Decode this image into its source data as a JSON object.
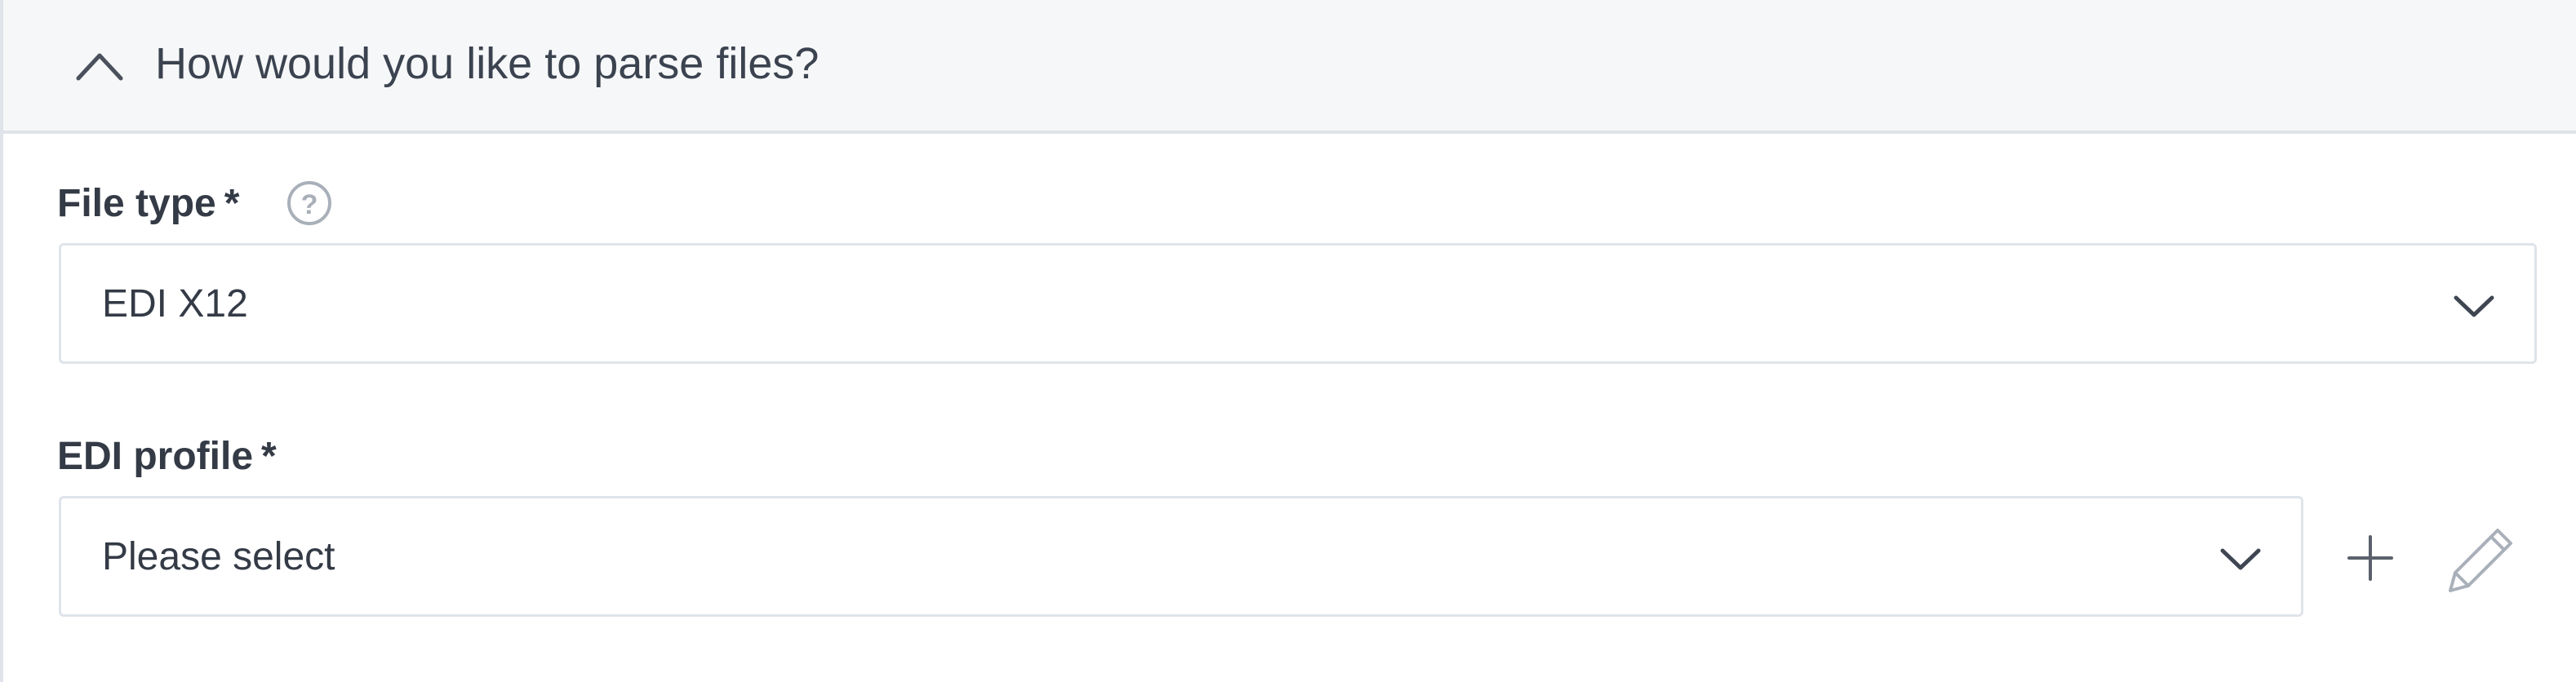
{
  "section": {
    "title": "How would you like to parse files?",
    "toggle_icon": "chevron-up-icon"
  },
  "file_type": {
    "label": "File type",
    "required_marker": "*",
    "help_icon": "help-circle-icon",
    "selected_value": "EDI X12",
    "dropdown_icon": "chevron-down-icon"
  },
  "edi_profile": {
    "label": "EDI profile",
    "required_marker": "*",
    "selected_value": "Please select",
    "dropdown_icon": "chevron-down-icon",
    "add_icon": "plus-icon",
    "edit_icon": "pencil-icon"
  },
  "colors": {
    "header_background": "#f6f7f8",
    "border": "#dfe4ea",
    "text": "#343b46",
    "icon_muted": "#a9b0b9",
    "icon": "#5a616c"
  }
}
